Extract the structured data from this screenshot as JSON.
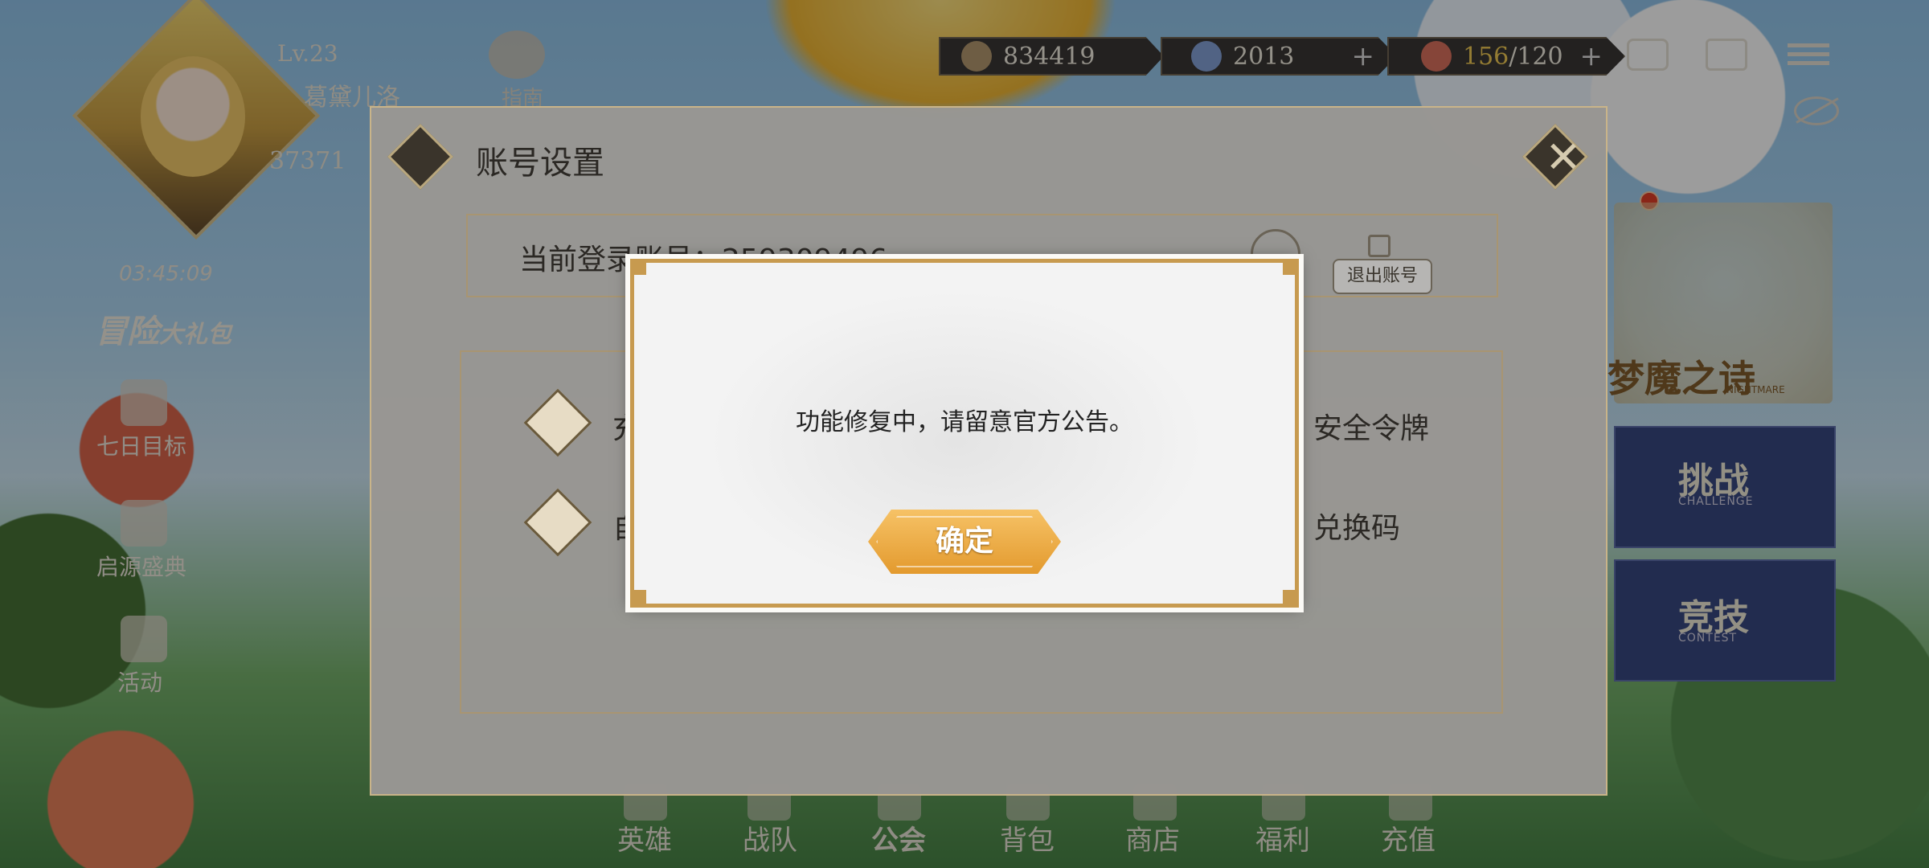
{
  "colors": {
    "accent": "#c79a4f",
    "button": "#e8a53c",
    "highlight": "#f1c94a"
  },
  "player": {
    "level": "Lv.23",
    "name": "葛黛儿洛",
    "power": "37371"
  },
  "guide": {
    "label": "指南"
  },
  "resources": {
    "gold": "834419",
    "gems": "2013",
    "stamina_current": "156",
    "stamina_max": "/120"
  },
  "top_icons": [
    "chat-icon",
    "album-icon",
    "menu-icon",
    "eye-hidden-icon"
  ],
  "promo": {
    "timer": "03:45:09",
    "title": "冒险",
    "title_suffix": "大礼包"
  },
  "left_menu": [
    {
      "label": "七日目标",
      "icon": "target-icon"
    },
    {
      "label": "启源盛典",
      "icon": "festival-icon"
    },
    {
      "label": "活动",
      "icon": "activity-icon"
    }
  ],
  "right_panels": {
    "nightmare": "梦魔之诗",
    "nightmare_sub": "NIGHTMARE",
    "challenge": "挑战",
    "challenge_sub": "CHALLENGE",
    "arena": "竞技",
    "arena_sub": "CONTEST"
  },
  "bottom_nav": [
    "英雄",
    "战队",
    "公会",
    "背包",
    "商店",
    "福利",
    "充值"
  ],
  "settings": {
    "title": "账号设置",
    "account_label": "当前登录账号：",
    "account_id": "259309496",
    "logout": "退出账号",
    "opt_recharge": "充",
    "opt_auto": "自",
    "opt_security": "安全令牌",
    "opt_redeem": "兑换码"
  },
  "modal": {
    "message": "功能修复中，请留意官方公告。",
    "confirm": "确定"
  }
}
